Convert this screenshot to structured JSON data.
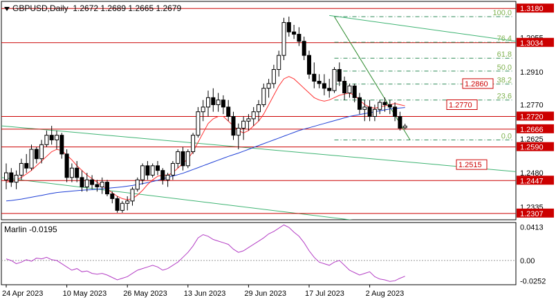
{
  "header": {
    "symbol": "GBPUSD,Daily",
    "ohlc": "1.2672 1.2689 1.2665 1.2679"
  },
  "indicator": {
    "name": "Marlin",
    "value": "-0.0195",
    "ticks": [
      "0.0413",
      "0.00",
      "-0.0252"
    ]
  },
  "colors": {
    "hline": "#cc0000",
    "fib": "#2e8b57",
    "fib_label": "#7fb24f",
    "trend": "#3cb371",
    "ma_fast": "#ff3030",
    "ma_slow": "#1e3fd6",
    "osc": "#b33cc4",
    "candle": "#000000",
    "arrow_line": "#2e8b2e"
  },
  "chart_data": {
    "type": "candlestick",
    "symbol": "GBPUSD",
    "timeframe": "Daily",
    "y_range": [
      1.228,
      1.321
    ],
    "price_ticks": [
      "1.3180",
      "1.3034",
      "1.2910",
      "1.2860",
      "1.2770",
      "1.2720",
      "1.2666",
      "1.2625",
      "1.2590",
      "1.2515",
      "1.2480",
      "1.2447",
      "1.2335",
      "1.2307"
    ],
    "price_ticks_grey": [
      "1.2055",
      "1.2910",
      "1.2770",
      "1.2625",
      "1.2480",
      "1.2335"
    ],
    "price_ticks_grey_values": [
      1.3055,
      1.291,
      1.277,
      1.2625,
      1.248,
      1.2335
    ],
    "x_labels": [
      "24 Apr 2023",
      "10 May 2023",
      "26 May 2023",
      "13 Jun 2023",
      "29 Jun 2023",
      "17 Jul 2023",
      "2 Aug 2023"
    ],
    "x_label_index": [
      0,
      12,
      24,
      36,
      48,
      60,
      72
    ],
    "levels": [
      {
        "label": "1.3180",
        "value": 1.318
      },
      {
        "label": "1.3034",
        "value": 1.3034
      },
      {
        "label": "1.2720",
        "value": 1.272
      },
      {
        "label": "1.2666",
        "value": 1.2666
      },
      {
        "label": "1.2590",
        "value": 1.259
      },
      {
        "label": "1.2447",
        "value": 1.2447
      },
      {
        "label": "1.2307",
        "value": 1.2307
      }
    ],
    "tags": [
      {
        "label": "1.2860",
        "value": 1.286
      },
      {
        "label": "1.2770",
        "value": 1.277
      },
      {
        "label": "1.2515",
        "value": 1.2515
      }
    ],
    "fibonacci": [
      {
        "label": "100.0",
        "value": 1.3145
      },
      {
        "label": "76.4",
        "value": 1.3036
      },
      {
        "label": "61.8",
        "value": 1.2968
      },
      {
        "label": "50.0",
        "value": 1.2913
      },
      {
        "label": "38.2",
        "value": 1.2858
      },
      {
        "label": "23.6",
        "value": 1.279
      },
      {
        "label": "0.0",
        "value": 1.262
      }
    ],
    "candles": [
      [
        1.245,
        1.252,
        1.241,
        1.248
      ],
      [
        1.248,
        1.25,
        1.242,
        1.244
      ],
      [
        1.244,
        1.249,
        1.241,
        1.247
      ],
      [
        1.247,
        1.254,
        1.245,
        1.252
      ],
      [
        1.252,
        1.256,
        1.248,
        1.25
      ],
      [
        1.25,
        1.26,
        1.249,
        1.258
      ],
      [
        1.258,
        1.259,
        1.252,
        1.254
      ],
      [
        1.254,
        1.262,
        1.252,
        1.26
      ],
      [
        1.26,
        1.266,
        1.259,
        1.264
      ],
      [
        1.264,
        1.268,
        1.26,
        1.262
      ],
      [
        1.262,
        1.266,
        1.258,
        1.264
      ],
      [
        1.264,
        1.265,
        1.254,
        1.256
      ],
      [
        1.256,
        1.258,
        1.244,
        1.246
      ],
      [
        1.246,
        1.252,
        1.244,
        1.25
      ],
      [
        1.25,
        1.253,
        1.244,
        1.246
      ],
      [
        1.246,
        1.249,
        1.24,
        1.242
      ],
      [
        1.242,
        1.248,
        1.24,
        1.245
      ],
      [
        1.245,
        1.247,
        1.241,
        1.243
      ],
      [
        1.243,
        1.245,
        1.24,
        1.242
      ],
      [
        1.242,
        1.246,
        1.239,
        1.244
      ],
      [
        1.244,
        1.245,
        1.238,
        1.239
      ],
      [
        1.239,
        1.24,
        1.235,
        1.237
      ],
      [
        1.237,
        1.238,
        1.231,
        1.232
      ],
      [
        1.232,
        1.236,
        1.231,
        1.235
      ],
      [
        1.235,
        1.238,
        1.232,
        1.236
      ],
      [
        1.236,
        1.242,
        1.234,
        1.241
      ],
      [
        1.241,
        1.246,
        1.24,
        1.245
      ],
      [
        1.245,
        1.252,
        1.243,
        1.251
      ],
      [
        1.251,
        1.253,
        1.245,
        1.247
      ],
      [
        1.247,
        1.252,
        1.246,
        1.251
      ],
      [
        1.251,
        1.253,
        1.247,
        1.249
      ],
      [
        1.249,
        1.25,
        1.243,
        1.245
      ],
      [
        1.245,
        1.248,
        1.242,
        1.247
      ],
      [
        1.247,
        1.253,
        1.245,
        1.252
      ],
      [
        1.252,
        1.258,
        1.25,
        1.257
      ],
      [
        1.257,
        1.259,
        1.249,
        1.251
      ],
      [
        1.251,
        1.258,
        1.25,
        1.257
      ],
      [
        1.257,
        1.265,
        1.256,
        1.264
      ],
      [
        1.264,
        1.276,
        1.263,
        1.274
      ],
      [
        1.274,
        1.279,
        1.27,
        1.276
      ],
      [
        1.276,
        1.283,
        1.272,
        1.28
      ],
      [
        1.28,
        1.284,
        1.274,
        1.277
      ],
      [
        1.277,
        1.282,
        1.274,
        1.279
      ],
      [
        1.279,
        1.281,
        1.273,
        1.276
      ],
      [
        1.276,
        1.279,
        1.27,
        1.272
      ],
      [
        1.272,
        1.274,
        1.262,
        1.264
      ],
      [
        1.264,
        1.269,
        1.258,
        1.267
      ],
      [
        1.267,
        1.272,
        1.262,
        1.27
      ],
      [
        1.27,
        1.273,
        1.266,
        1.271
      ],
      [
        1.271,
        1.276,
        1.268,
        1.274
      ],
      [
        1.274,
        1.279,
        1.27,
        1.277
      ],
      [
        1.277,
        1.286,
        1.276,
        1.284
      ],
      [
        1.284,
        1.288,
        1.28,
        1.286
      ],
      [
        1.286,
        1.294,
        1.284,
        1.292
      ],
      [
        1.292,
        1.3,
        1.289,
        1.298
      ],
      [
        1.298,
        1.314,
        1.296,
        1.312
      ],
      [
        1.312,
        1.3145,
        1.306,
        1.308
      ],
      [
        1.308,
        1.311,
        1.305,
        1.307
      ],
      [
        1.307,
        1.31,
        1.302,
        1.304
      ],
      [
        1.304,
        1.306,
        1.296,
        1.298
      ],
      [
        1.298,
        1.3,
        1.288,
        1.29
      ],
      [
        1.29,
        1.295,
        1.284,
        1.287
      ],
      [
        1.287,
        1.29,
        1.284,
        1.286
      ],
      [
        1.286,
        1.29,
        1.281,
        1.284
      ],
      [
        1.284,
        1.288,
        1.28,
        1.283
      ],
      [
        1.283,
        1.293,
        1.282,
        1.292
      ],
      [
        1.292,
        1.295,
        1.285,
        1.287
      ],
      [
        1.287,
        1.289,
        1.279,
        1.282
      ],
      [
        1.282,
        1.286,
        1.28,
        1.285
      ],
      [
        1.285,
        1.286,
        1.278,
        1.28
      ],
      [
        1.28,
        1.282,
        1.273,
        1.275
      ],
      [
        1.275,
        1.279,
        1.27,
        1.276
      ],
      [
        1.276,
        1.279,
        1.27,
        1.272
      ],
      [
        1.272,
        1.277,
        1.27,
        1.275
      ],
      [
        1.275,
        1.279,
        1.273,
        1.278
      ],
      [
        1.278,
        1.28,
        1.274,
        1.277
      ],
      [
        1.277,
        1.279,
        1.273,
        1.276
      ],
      [
        1.276,
        1.278,
        1.27,
        1.272
      ],
      [
        1.272,
        1.274,
        1.266,
        1.267
      ],
      [
        1.2672,
        1.2689,
        1.2665,
        1.2679
      ]
    ],
    "ma_fast": [
      1.244,
      1.2445,
      1.245,
      1.246,
      1.2475,
      1.249,
      1.251,
      1.253,
      1.255,
      1.257,
      1.258,
      1.2575,
      1.2555,
      1.2535,
      1.251,
      1.249,
      1.247,
      1.2455,
      1.244,
      1.2425,
      1.241,
      1.2395,
      1.238,
      1.237,
      1.2365,
      1.237,
      1.2385,
      1.2405,
      1.243,
      1.245,
      1.2465,
      1.247,
      1.247,
      1.248,
      1.25,
      1.252,
      1.254,
      1.257,
      1.261,
      1.265,
      1.269,
      1.271,
      1.272,
      1.272,
      1.27,
      1.268,
      1.266,
      1.265,
      1.266,
      1.268,
      1.27,
      1.273,
      1.277,
      1.281,
      1.285,
      1.288,
      1.289,
      1.288,
      1.286,
      1.284,
      1.282,
      1.28,
      1.279,
      1.2785,
      1.279,
      1.28,
      1.281,
      1.2815,
      1.282,
      1.281,
      1.279,
      1.277,
      1.276,
      1.2755,
      1.276,
      1.2765,
      1.277,
      1.2775,
      1.277,
      1.2765
    ],
    "ma_slow": [
      1.236,
      1.2362,
      1.2365,
      1.2368,
      1.2372,
      1.2376,
      1.238,
      1.2384,
      1.2388,
      1.2392,
      1.2396,
      1.2398,
      1.24,
      1.2402,
      1.2404,
      1.2406,
      1.2407,
      1.2408,
      1.241,
      1.2412,
      1.2414,
      1.2416,
      1.2418,
      1.242,
      1.2423,
      1.2426,
      1.243,
      1.2434,
      1.2438,
      1.2443,
      1.2448,
      1.2454,
      1.246,
      1.2466,
      1.2472,
      1.2478,
      1.2486,
      1.2494,
      1.2502,
      1.251,
      1.2518,
      1.2526,
      1.2534,
      1.2542,
      1.255,
      1.2557,
      1.2564,
      1.2572,
      1.258,
      1.2588,
      1.2596,
      1.2604,
      1.2612,
      1.262,
      1.2628,
      1.2636,
      1.2644,
      1.2652,
      1.266,
      1.2666,
      1.2672,
      1.2678,
      1.2684,
      1.269,
      1.2696,
      1.2702,
      1.2708,
      1.2714,
      1.272,
      1.2724,
      1.2728,
      1.2732,
      1.2736,
      1.274,
      1.2744,
      1.2748,
      1.2752,
      1.2754,
      1.2756,
      1.2758
    ],
    "marlin_range": [
      -0.03,
      0.047
    ],
    "marlin": [
      0.002,
      0.0,
      -0.004,
      -0.002,
      0.001,
      -0.001,
      0.003,
      0.002,
      0.004,
      0.001,
      0.0,
      -0.004,
      -0.008,
      -0.012,
      -0.01,
      -0.014,
      -0.013,
      -0.016,
      -0.017,
      -0.016,
      -0.018,
      -0.021,
      -0.024,
      -0.022,
      -0.02,
      -0.016,
      -0.012,
      -0.01,
      -0.008,
      -0.006,
      -0.008,
      -0.012,
      -0.01,
      -0.006,
      -0.002,
      0.004,
      0.01,
      0.018,
      0.028,
      0.032,
      0.03,
      0.026,
      0.024,
      0.022,
      0.02,
      0.014,
      0.01,
      0.012,
      0.016,
      0.02,
      0.024,
      0.028,
      0.033,
      0.036,
      0.04,
      0.044,
      0.041,
      0.035,
      0.03,
      0.022,
      0.012,
      0.004,
      -0.002,
      -0.004,
      -0.006,
      -0.002,
      0.0,
      -0.006,
      -0.012,
      -0.015,
      -0.018,
      -0.016,
      -0.014,
      -0.02,
      -0.023,
      -0.024,
      -0.026,
      -0.025,
      -0.022,
      -0.0195
    ]
  }
}
